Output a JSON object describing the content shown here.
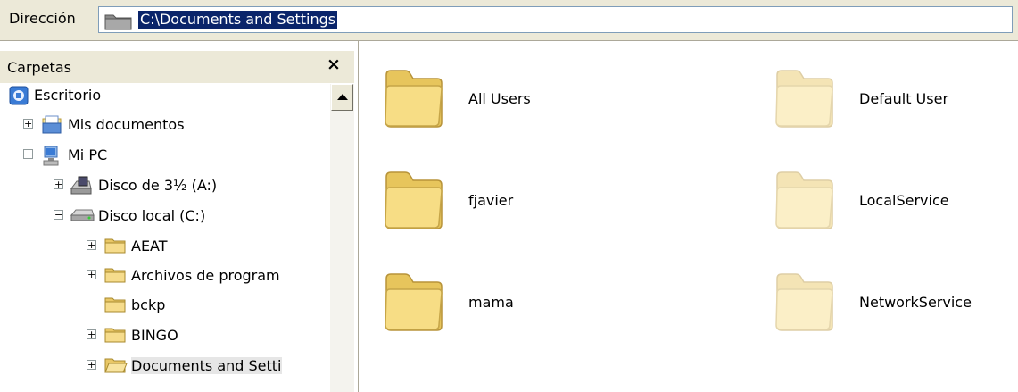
{
  "address": {
    "label": "Dirección",
    "path": "C:\\Documents and Settings"
  },
  "folders_pane": {
    "title": "Carpetas",
    "close": "×",
    "tree": [
      {
        "label": "Escritorio",
        "icon": "desktop-icon"
      },
      {
        "label": "Mis documentos",
        "icon": "my-documents-icon",
        "expander": "+"
      },
      {
        "label": "Mi PC",
        "icon": "my-computer-icon",
        "expander": "−"
      },
      {
        "label": "Disco de 3½ (A:)",
        "icon": "floppy-drive-icon",
        "expander": "+"
      },
      {
        "label": "Disco local (C:)",
        "icon": "hard-drive-icon",
        "expander": "−"
      },
      {
        "label": "AEAT",
        "icon": "folder-icon",
        "expander": "+"
      },
      {
        "label": "Archivos de program",
        "icon": "folder-icon",
        "expander": "+"
      },
      {
        "label": "bckp",
        "icon": "folder-icon"
      },
      {
        "label": "BINGO",
        "icon": "folder-icon",
        "expander": "+"
      },
      {
        "label": "Documents and Setti",
        "icon": "open-folder-icon",
        "expander": "+",
        "selected": true
      }
    ]
  },
  "content": {
    "items": [
      {
        "name": "All Users",
        "hidden": false
      },
      {
        "name": "Default User",
        "hidden": true
      },
      {
        "name": "fjavier",
        "hidden": false
      },
      {
        "name": "LocalService",
        "hidden": true
      },
      {
        "name": "mama",
        "hidden": false
      },
      {
        "name": "NetworkService",
        "hidden": true
      }
    ]
  },
  "colors": {
    "chrome": "#ece9d8",
    "selection": "#0a246a",
    "folder": "#f3d27a"
  }
}
